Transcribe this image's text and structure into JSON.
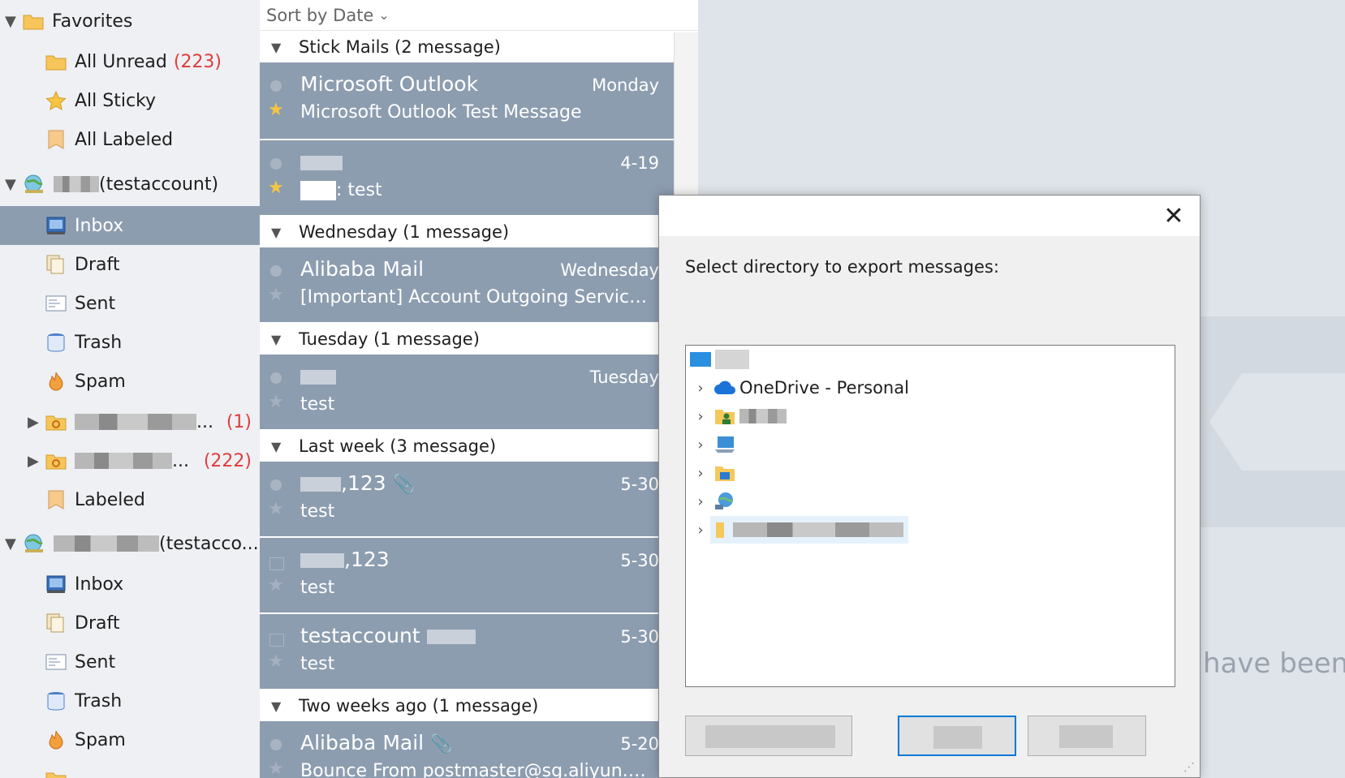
{
  "sidebar": {
    "favorites": {
      "label": "Favorites",
      "items": [
        {
          "label": "All Unread",
          "count": "(223)"
        },
        {
          "label": "All Sticky"
        },
        {
          "label": "All Labeled"
        }
      ]
    },
    "account1": {
      "label": "(testaccount)",
      "folders": [
        "Inbox",
        "Draft",
        "Sent",
        "Trash",
        "Spam"
      ],
      "sync_folders": [
        {
          "label": "...",
          "count": "(1)"
        },
        {
          "label": "...",
          "count": "(222)"
        }
      ],
      "labeled": "Labeled"
    },
    "account2": {
      "label": "(testacco...",
      "folders": [
        "Inbox",
        "Draft",
        "Sent",
        "Trash",
        "Spam"
      ]
    }
  },
  "maillist": {
    "sort_label": "Sort by Date",
    "groups": [
      {
        "label": "Stick Mails (2 message)"
      },
      {
        "label": "Wednesday (1 message)"
      },
      {
        "label": "Tuesday (1 message)"
      },
      {
        "label": "Last week (3 message)"
      },
      {
        "label": "Two weeks ago (1 message)"
      }
    ],
    "mails": [
      {
        "from": "Microsoft Outlook",
        "date": "Monday",
        "subject": "Microsoft Outlook Test Message"
      },
      {
        "from": "",
        "date": "4-19",
        "subject": ":  test"
      },
      {
        "from": "Alibaba Mail",
        "date": "Wednesday",
        "subject": "[Important] Account Outgoing Service Cl..."
      },
      {
        "from": "",
        "date": "Tuesday",
        "subject": "test"
      },
      {
        "from": ",123",
        "date": "5-30",
        "subject": "test"
      },
      {
        "from": ",123",
        "date": "5-30",
        "subject": "test"
      },
      {
        "from": "testaccount",
        "date": "5-30",
        "subject": "test"
      },
      {
        "from": "Alibaba Mail",
        "date": "5-20",
        "subject": "Bounce From postmaster@sg.aliyun.com"
      }
    ]
  },
  "background_text": "have been s",
  "dialog": {
    "prompt": "Select directory to export messages:",
    "tree": [
      {
        "label": "OneDrive - Personal"
      }
    ]
  },
  "colors": {
    "selected_row": "#8d9db0",
    "unread_count": "#e03c3c",
    "star_on": "#f5c542",
    "dialog_focus": "#0078d7"
  }
}
